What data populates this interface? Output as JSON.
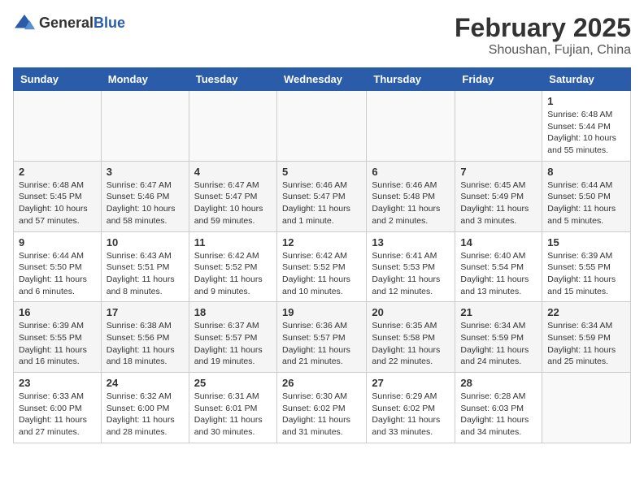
{
  "header": {
    "logo_general": "General",
    "logo_blue": "Blue",
    "month_year": "February 2025",
    "location": "Shoushan, Fujian, China"
  },
  "days_of_week": [
    "Sunday",
    "Monday",
    "Tuesday",
    "Wednesday",
    "Thursday",
    "Friday",
    "Saturday"
  ],
  "weeks": [
    {
      "cells": [
        {
          "day": "",
          "info": ""
        },
        {
          "day": "",
          "info": ""
        },
        {
          "day": "",
          "info": ""
        },
        {
          "day": "",
          "info": ""
        },
        {
          "day": "",
          "info": ""
        },
        {
          "day": "",
          "info": ""
        },
        {
          "day": "1",
          "info": "Sunrise: 6:48 AM\nSunset: 5:44 PM\nDaylight: 10 hours\nand 55 minutes."
        }
      ]
    },
    {
      "cells": [
        {
          "day": "2",
          "info": "Sunrise: 6:48 AM\nSunset: 5:45 PM\nDaylight: 10 hours\nand 57 minutes."
        },
        {
          "day": "3",
          "info": "Sunrise: 6:47 AM\nSunset: 5:46 PM\nDaylight: 10 hours\nand 58 minutes."
        },
        {
          "day": "4",
          "info": "Sunrise: 6:47 AM\nSunset: 5:47 PM\nDaylight: 10 hours\nand 59 minutes."
        },
        {
          "day": "5",
          "info": "Sunrise: 6:46 AM\nSunset: 5:47 PM\nDaylight: 11 hours\nand 1 minute."
        },
        {
          "day": "6",
          "info": "Sunrise: 6:46 AM\nSunset: 5:48 PM\nDaylight: 11 hours\nand 2 minutes."
        },
        {
          "day": "7",
          "info": "Sunrise: 6:45 AM\nSunset: 5:49 PM\nDaylight: 11 hours\nand 3 minutes."
        },
        {
          "day": "8",
          "info": "Sunrise: 6:44 AM\nSunset: 5:50 PM\nDaylight: 11 hours\nand 5 minutes."
        }
      ]
    },
    {
      "cells": [
        {
          "day": "9",
          "info": "Sunrise: 6:44 AM\nSunset: 5:50 PM\nDaylight: 11 hours\nand 6 minutes."
        },
        {
          "day": "10",
          "info": "Sunrise: 6:43 AM\nSunset: 5:51 PM\nDaylight: 11 hours\nand 8 minutes."
        },
        {
          "day": "11",
          "info": "Sunrise: 6:42 AM\nSunset: 5:52 PM\nDaylight: 11 hours\nand 9 minutes."
        },
        {
          "day": "12",
          "info": "Sunrise: 6:42 AM\nSunset: 5:52 PM\nDaylight: 11 hours\nand 10 minutes."
        },
        {
          "day": "13",
          "info": "Sunrise: 6:41 AM\nSunset: 5:53 PM\nDaylight: 11 hours\nand 12 minutes."
        },
        {
          "day": "14",
          "info": "Sunrise: 6:40 AM\nSunset: 5:54 PM\nDaylight: 11 hours\nand 13 minutes."
        },
        {
          "day": "15",
          "info": "Sunrise: 6:39 AM\nSunset: 5:55 PM\nDaylight: 11 hours\nand 15 minutes."
        }
      ]
    },
    {
      "cells": [
        {
          "day": "16",
          "info": "Sunrise: 6:39 AM\nSunset: 5:55 PM\nDaylight: 11 hours\nand 16 minutes."
        },
        {
          "day": "17",
          "info": "Sunrise: 6:38 AM\nSunset: 5:56 PM\nDaylight: 11 hours\nand 18 minutes."
        },
        {
          "day": "18",
          "info": "Sunrise: 6:37 AM\nSunset: 5:57 PM\nDaylight: 11 hours\nand 19 minutes."
        },
        {
          "day": "19",
          "info": "Sunrise: 6:36 AM\nSunset: 5:57 PM\nDaylight: 11 hours\nand 21 minutes."
        },
        {
          "day": "20",
          "info": "Sunrise: 6:35 AM\nSunset: 5:58 PM\nDaylight: 11 hours\nand 22 minutes."
        },
        {
          "day": "21",
          "info": "Sunrise: 6:34 AM\nSunset: 5:59 PM\nDaylight: 11 hours\nand 24 minutes."
        },
        {
          "day": "22",
          "info": "Sunrise: 6:34 AM\nSunset: 5:59 PM\nDaylight: 11 hours\nand 25 minutes."
        }
      ]
    },
    {
      "cells": [
        {
          "day": "23",
          "info": "Sunrise: 6:33 AM\nSunset: 6:00 PM\nDaylight: 11 hours\nand 27 minutes."
        },
        {
          "day": "24",
          "info": "Sunrise: 6:32 AM\nSunset: 6:00 PM\nDaylight: 11 hours\nand 28 minutes."
        },
        {
          "day": "25",
          "info": "Sunrise: 6:31 AM\nSunset: 6:01 PM\nDaylight: 11 hours\nand 30 minutes."
        },
        {
          "day": "26",
          "info": "Sunrise: 6:30 AM\nSunset: 6:02 PM\nDaylight: 11 hours\nand 31 minutes."
        },
        {
          "day": "27",
          "info": "Sunrise: 6:29 AM\nSunset: 6:02 PM\nDaylight: 11 hours\nand 33 minutes."
        },
        {
          "day": "28",
          "info": "Sunrise: 6:28 AM\nSunset: 6:03 PM\nDaylight: 11 hours\nand 34 minutes."
        },
        {
          "day": "",
          "info": ""
        }
      ]
    }
  ]
}
